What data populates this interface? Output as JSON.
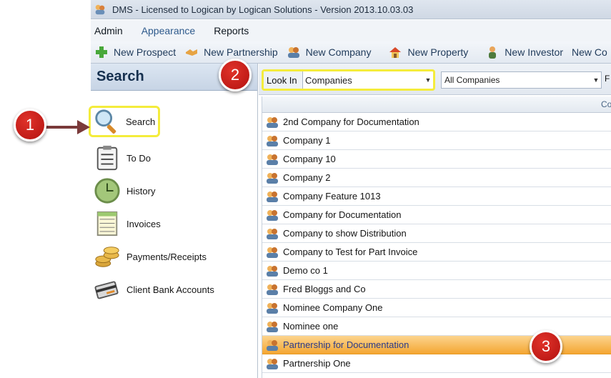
{
  "window": {
    "title": "DMS - Licensed to Logican by Logican Solutions - Version 2013.10.03.03"
  },
  "menu": {
    "items": [
      "Admin",
      "Appearance",
      "Reports"
    ]
  },
  "toolbar": {
    "buttons": [
      "New Prospect",
      "New Partnership",
      "New Company",
      "New Property",
      "New Investor",
      "New Co"
    ]
  },
  "nav": {
    "header": "Search",
    "items": [
      {
        "label": "Search",
        "icon": "magnifier-icon"
      },
      {
        "label": "To Do",
        "icon": "clipboard-icon"
      },
      {
        "label": "History",
        "icon": "clock-icon"
      },
      {
        "label": "Invoices",
        "icon": "ledger-icon"
      },
      {
        "label": "Payments/Receipts",
        "icon": "coins-icon"
      },
      {
        "label": "Client Bank Accounts",
        "icon": "card-icon"
      }
    ]
  },
  "filters": {
    "look_in_label": "Look In",
    "look_in_value": "Companies",
    "scope_value": "All Companies",
    "next_label": "F"
  },
  "results": {
    "column_header": "Co",
    "rows": [
      "2nd Company for Documentation",
      "Company 1",
      "Company 10",
      "Company 2",
      "Company Feature 1013",
      "Company for Documentation",
      "Company to show Distribution",
      "Company to Test for Part Invoice",
      "Demo co 1",
      "Fred Bloggs and Co",
      "Nominee Company One",
      "Nominee one",
      "Partnership for Documentation",
      "Partnership One"
    ],
    "selected_row": "Partnership for Documentation"
  },
  "callouts": [
    "1",
    "2",
    "3"
  ],
  "colors": {
    "highlight": "#f4ec3c",
    "selected_row": "#f4a632",
    "callout": "#c7211c"
  }
}
